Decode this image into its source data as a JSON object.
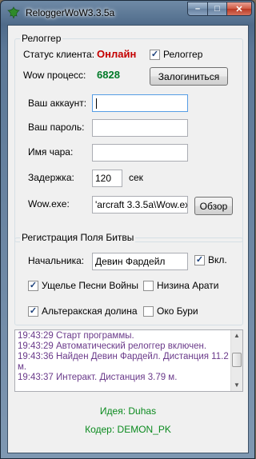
{
  "window": {
    "title": "ReloggerWoW3.3.5a"
  },
  "relogger_group": {
    "legend": "Релоггер",
    "status_label": "Статус клиента:",
    "status_value": "Онлайн",
    "relogger_checkbox_label": "Релоггер",
    "relogger_checked": true,
    "process_label": "Wow процесс:",
    "process_value": "6828",
    "login_button": "Залогиниться",
    "account_label": "Ваш аккаунт:",
    "account_value": "",
    "password_label": "Ваш пароль:",
    "password_value": "",
    "char_label": "Имя чара:",
    "char_value": "",
    "delay_label": "Задержка:",
    "delay_value": "120",
    "delay_unit": "сек",
    "wowexe_label": "Wow.exe:",
    "wowexe_value": "'arcraft 3.3.5a\\Wow.exe",
    "browse_button": "Обзор"
  },
  "bg_group": {
    "legend": "Регистрация Поля Битвы",
    "leader_label": "Начальника:",
    "leader_value": "Девин Фардейл",
    "enabled_label": "Вкл.",
    "enabled_checked": true,
    "battlegrounds": [
      {
        "label": "Ущелье Песни Войны",
        "checked": true
      },
      {
        "label": "Низина Арати",
        "checked": false
      },
      {
        "label": "Альтеракская долина",
        "checked": true
      },
      {
        "label": "Око Бури",
        "checked": false
      }
    ]
  },
  "log": {
    "lines": [
      "19:43:29 Старт программы.",
      "19:43:29 Автоматический релоггер включен.",
      "19:43:36 Найден Девин Фардейл. Дистанция 11.2 м.",
      "19:43:37 Интеракт. Дистанция 3.79 м."
    ]
  },
  "credits": {
    "idea": "Идея: Duhas",
    "coder": "Кодер: DEMON_PK"
  },
  "colors": {
    "status_online": "#c40000",
    "process_id": "#007a28",
    "log_text": "#6a3a8a",
    "credits": "#0a8a1e"
  }
}
